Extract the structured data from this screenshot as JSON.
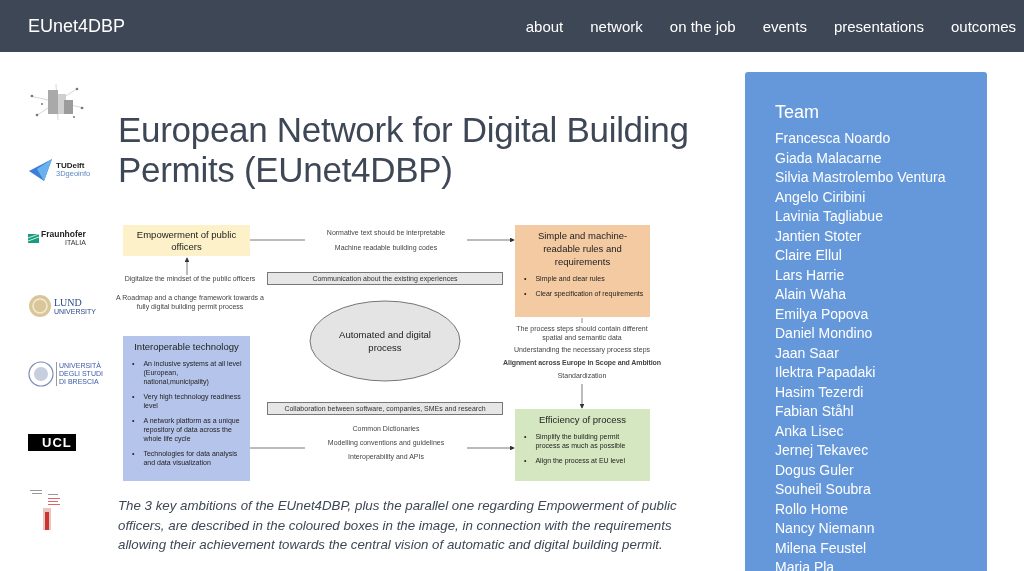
{
  "header": {
    "brand": "EUnet4DBP",
    "nav": [
      "about",
      "network",
      "on the job",
      "events",
      "presentations",
      "outcomes"
    ]
  },
  "logos": [
    {
      "kind": "network"
    },
    {
      "kind": "delft",
      "texts": [
        "TUDelft",
        "3Dgeoinfo"
      ]
    },
    {
      "kind": "fraunhofer",
      "texts": [
        "Fraunhofer",
        "ITALIA"
      ]
    },
    {
      "kind": "lund",
      "texts": [
        "LUND",
        "UNIVERSITY"
      ]
    },
    {
      "kind": "brescia",
      "texts": [
        "UNIVERSITÀ",
        "DEGLI STUDI",
        "DI BRESCIA"
      ]
    },
    {
      "kind": "ucl",
      "texts": [
        "UCL"
      ]
    },
    {
      "kind": "tower"
    }
  ],
  "title": "European Network for Digital Building Permits (EUnet4DBP)",
  "diagram": {
    "boxes": [
      {
        "title": "Empowerment of public officers",
        "color": "#fdf1c9"
      },
      {
        "title": "Simple and machine-readable rules and requirements",
        "color": "#f4caa2",
        "bullets": [
          "Simple and clear rules",
          "Clear specification of requirements"
        ]
      },
      {
        "title": "Interoperable technology",
        "color": "#b5c4ea",
        "bullets": [
          "An inclusive systems at all level (European, national,municipality)",
          "Very high technology readiness level",
          "A network platform as a unique repository of data across the whole life cycle",
          "Technologies for data analysis and data visualization"
        ]
      },
      {
        "title": "Efficiency of process",
        "color": "#d5e7c0",
        "bullets": [
          "Simplify the building permit process as much as possible",
          "Align the process at EU level"
        ]
      }
    ],
    "bullet_marker": "•",
    "center": "Automated and digital process",
    "bars": [
      "Communication about the existing experiences",
      "Collaboration between software, companies, SMEs and research"
    ],
    "top_notes": [
      "Normative text should be interpretable",
      "Machine readable building codes"
    ],
    "officer_notes": [
      "Digitalize the mindset of the public officers",
      "A Roadmap and a change framework towards a fully digital building permit process"
    ],
    "process_notes": [
      "The process steps should contain different spatial and semantic data",
      "Understanding the necessary process steps",
      "Alignment across Europe in Scope and Ambition",
      "Standardization"
    ],
    "bottom_notes": [
      "Common Dictionaries",
      "Modelling conventions and guidelines",
      "Interoperability and APIs"
    ]
  },
  "caption": "The 3 key ambitions of the EUnet4DBP, plus the parallel one regarding Empowerment of public officers, are described in the coloured boxes in the image, in connection with the requirements allowing their achievement towards the central vision of automatic and digital building permit.",
  "sidebar": {
    "heading": "Team",
    "members": [
      "Francesca Noardo",
      "Giada Malacarne",
      "Silvia Mastrolembo Ventura",
      "Angelo Ciribini",
      "Lavinia Tagliabue",
      "Jantien Stoter",
      "Claire Ellul",
      "Lars Harrie",
      "Alain Waha",
      "Emilya Popova",
      "Daniel Mondino",
      "Jaan Saar",
      "Ilektra Papadaki",
      "Hasim Tezerdi",
      "Fabian Ståhl",
      "Anka Lisec",
      "Jernej Tekavec",
      "Dogus Guler",
      "Souheil Soubra",
      "Rollo Home",
      "Nancy Niemann",
      "Milena Feustel",
      "Maria Pla"
    ]
  }
}
